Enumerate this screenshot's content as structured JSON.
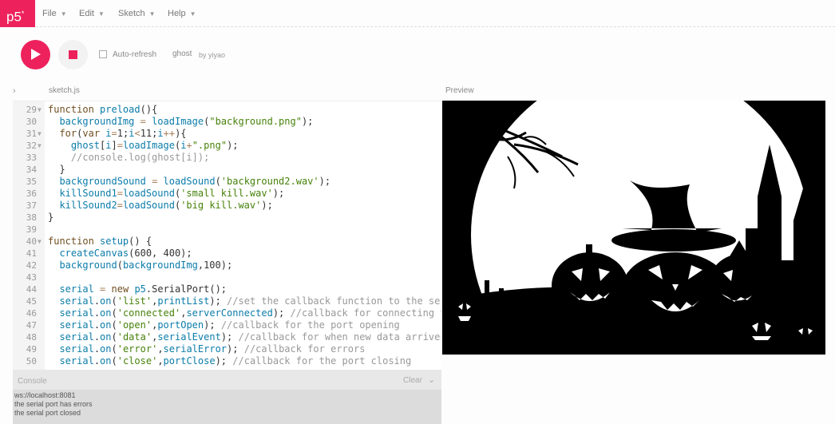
{
  "menubar": {
    "logo": "p5",
    "logo_sup": "*",
    "items": [
      {
        "label": "File"
      },
      {
        "label": "Edit"
      },
      {
        "label": "Sketch"
      },
      {
        "label": "Help"
      }
    ]
  },
  "toolbar": {
    "auto_refresh_label": "Auto-refresh",
    "sketch_name": "ghost",
    "author": "by yiyao"
  },
  "editor": {
    "tab_label": "sketch.js",
    "lines": [
      {
        "num": "29",
        "fold": "▼"
      },
      {
        "num": "30",
        "fold": ""
      },
      {
        "num": "31",
        "fold": "▼"
      },
      {
        "num": "32",
        "fold": "▼"
      },
      {
        "num": "33",
        "fold": ""
      },
      {
        "num": "34",
        "fold": ""
      },
      {
        "num": "35",
        "fold": ""
      },
      {
        "num": "36",
        "fold": ""
      },
      {
        "num": "37",
        "fold": ""
      },
      {
        "num": "38",
        "fold": ""
      },
      {
        "num": "39",
        "fold": ""
      },
      {
        "num": "40",
        "fold": "▼"
      },
      {
        "num": "41",
        "fold": ""
      },
      {
        "num": "42",
        "fold": ""
      },
      {
        "num": "43",
        "fold": ""
      },
      {
        "num": "44",
        "fold": ""
      },
      {
        "num": "45",
        "fold": ""
      },
      {
        "num": "46",
        "fold": ""
      },
      {
        "num": "47",
        "fold": ""
      },
      {
        "num": "48",
        "fold": ""
      },
      {
        "num": "49",
        "fold": ""
      },
      {
        "num": "50",
        "fold": ""
      }
    ]
  },
  "preview": {
    "label": "Preview"
  },
  "console": {
    "title": "Console",
    "clear_label": "Clear",
    "messages": [
      "ws://localhost:8081",
      "the serial port has errors",
      "the serial port closed"
    ]
  },
  "colors": {
    "accent": "#ed225d"
  }
}
